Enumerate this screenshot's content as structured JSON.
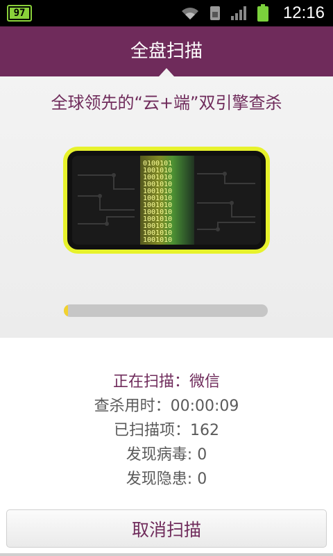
{
  "status_bar": {
    "badge_number": "97",
    "time": "12:16",
    "icons": [
      "wifi-icon",
      "sim-icon",
      "signal-icon",
      "battery-icon"
    ],
    "battery_color": "#7bd13c"
  },
  "header": {
    "title": "全盘扫描",
    "color": "#6f2b5b"
  },
  "hero": {
    "slogan": "全球领先的“云+端”双引擎查杀",
    "scan_progress_fraction": 0.02,
    "scanner_binary_rows": [
      "0100101",
      "1001010",
      "1001010",
      "1001010",
      "1001010",
      "1001010",
      "1001010",
      "1001010",
      "1001010",
      "1001010",
      "1001010",
      "1001010"
    ]
  },
  "stats": {
    "current_label": "正在扫描：微信",
    "elapsed_label": "查杀用时：00:00:09",
    "scanned_label": "已扫描项：162",
    "virus_label": "发现病毒: 0",
    "risk_label": "发现隐患: 0"
  },
  "actions": {
    "cancel_label": "取消扫描"
  }
}
